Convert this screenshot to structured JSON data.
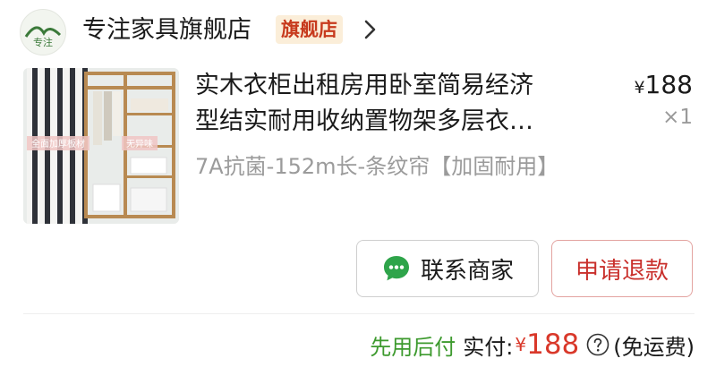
{
  "shop": {
    "logo_text": "专注",
    "name": "专注家具旗舰店",
    "badge": "旗舰店"
  },
  "product": {
    "image_overlay_texts": [
      "全面加厚板材",
      "无异味"
    ],
    "title_line1": "实木衣柜出租房用卧室简易经济",
    "title_line2": "型结实耐用收纳置物架多层衣…",
    "price_currency": "¥",
    "price_value": "188",
    "quantity": "×1",
    "variant": "7A抗菌-152m长-条纹帘【加固耐用】"
  },
  "actions": {
    "contact_label": "联系商家",
    "refund_label": "申请退款"
  },
  "footer": {
    "pay_later": "先用后付",
    "paid_label": "实付:",
    "paid_currency": "¥",
    "paid_amount": "188",
    "shipping": "(免运费)"
  },
  "colors": {
    "accent_red": "#c9302c",
    "pay_later_green": "#3d9a2e",
    "badge_bg": "#fbeed9"
  },
  "icons": [
    "shop-logo",
    "chevron-right-icon",
    "chat-bubble-icon",
    "help-icon"
  ]
}
